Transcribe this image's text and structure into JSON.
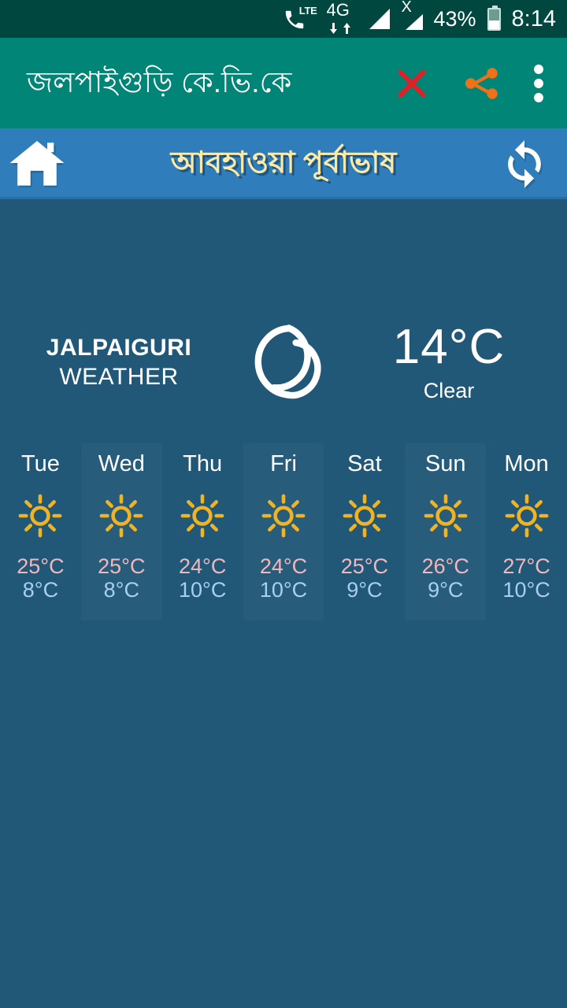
{
  "status_bar": {
    "call_icon": "phone-lte-icon",
    "lte_label": "LTE",
    "network_label": "4G",
    "data_arrows_icon": "data-transfer-arrows-icon",
    "signal1_icon": "signal-bars-icon",
    "signal2_icon": "signal-bars-no-service-icon",
    "no_service_label": "X",
    "battery_percent": "43%",
    "battery_icon": "battery-icon",
    "time": "8:14"
  },
  "app_bar": {
    "title": "জলপাইগুড়ি কে.ভি.কে",
    "close_icon": "close-icon",
    "share_icon": "share-icon",
    "overflow_icon": "overflow-menu-icon",
    "bg_color": "#018577"
  },
  "sub_bar": {
    "home_icon": "home-icon",
    "title": "আবহাওয়া পূর্বাভাষ",
    "refresh_icon": "refresh-icon",
    "bg_color": "#2f7ebb",
    "title_color": "#fbe9a6"
  },
  "current": {
    "city": "JALPAIGURI",
    "subtitle": "WEATHER",
    "condition_icon": "moon-icon",
    "temperature": "14°C",
    "description": "Clear"
  },
  "forecast": {
    "days": [
      {
        "day": "Tue",
        "icon": "sun-icon",
        "high": "25°C",
        "low": "8°C"
      },
      {
        "day": "Wed",
        "icon": "sun-icon",
        "high": "25°C",
        "low": "8°C"
      },
      {
        "day": "Thu",
        "icon": "sun-icon",
        "high": "24°C",
        "low": "10°C"
      },
      {
        "day": "Fri",
        "icon": "sun-icon",
        "high": "24°C",
        "low": "10°C"
      },
      {
        "day": "Sat",
        "icon": "sun-icon",
        "high": "25°C",
        "low": "9°C"
      },
      {
        "day": "Sun",
        "icon": "sun-icon",
        "high": "26°C",
        "low": "9°C"
      },
      {
        "day": "Mon",
        "icon": "sun-icon",
        "high": "27°C",
        "low": "10°C"
      }
    ],
    "high_color": "#f0b8bd",
    "low_color": "#a8cff2"
  },
  "page": {
    "background_color": "#215777"
  }
}
